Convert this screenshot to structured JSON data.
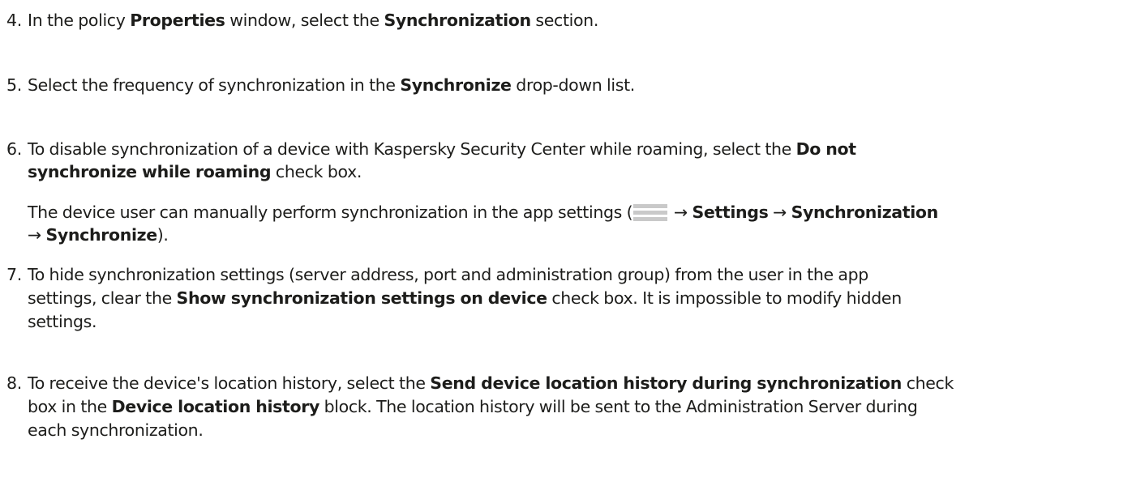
{
  "steps": [
    {
      "number": "4.",
      "t1": "In the policy ",
      "b1": "Properties",
      "t2": " window, select the ",
      "b2": "Synchronization",
      "t3": " section."
    },
    {
      "number": "5.",
      "t1": "Select the frequency of synchronization in the ",
      "b1": "Synchronize",
      "t2": " drop-down list."
    },
    {
      "number": "6.",
      "t1": "To disable synchronization of a device with Kaspersky Security Center while roaming, select the ",
      "b1": "Do not",
      "b1b": "synchronize while roaming",
      "t2": " check box.",
      "note": {
        "t1": "The device user can manually perform synchronization in the app settings (",
        "icon": "menu-icon",
        "arrow1": " → ",
        "b1": "Settings",
        "arrow2": " → ",
        "b2": "Synchronization",
        "arrow3": "→ ",
        "b3": "Synchronize",
        "t2": ")."
      }
    },
    {
      "number": "7.",
      "t1": "To hide synchronization settings (server address, port and administration group) from the user in the app",
      "t2": "settings, clear the ",
      "b1": "Show synchronization settings on device",
      "t3": " check box. It is impossible to modify hidden",
      "t4": "settings."
    },
    {
      "number": "8.",
      "t1": "To receive the device's location history, select the ",
      "b1": "Send device location history during synchronization",
      "t2": " check",
      "t3": "box in the ",
      "b2": "Device location history",
      "t4": " block. The location history will be sent to the Administration Server during",
      "t5": "each synchronization."
    }
  ]
}
